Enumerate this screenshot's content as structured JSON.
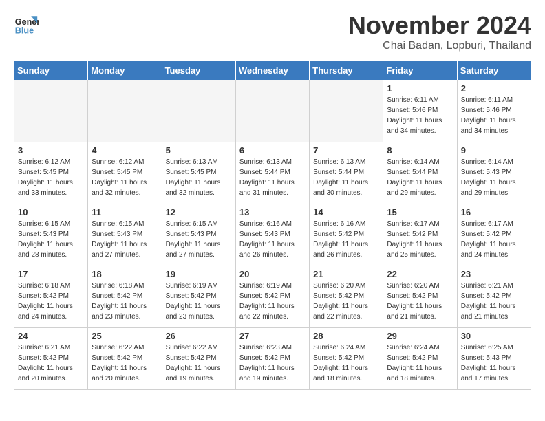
{
  "header": {
    "logo_line1": "General",
    "logo_line2": "Blue",
    "month": "November 2024",
    "location": "Chai Badan, Lopburi, Thailand"
  },
  "weekdays": [
    "Sunday",
    "Monday",
    "Tuesday",
    "Wednesday",
    "Thursday",
    "Friday",
    "Saturday"
  ],
  "weeks": [
    [
      {
        "day": "",
        "info": "",
        "empty": true
      },
      {
        "day": "",
        "info": "",
        "empty": true
      },
      {
        "day": "",
        "info": "",
        "empty": true
      },
      {
        "day": "",
        "info": "",
        "empty": true
      },
      {
        "day": "",
        "info": "",
        "empty": true
      },
      {
        "day": "1",
        "info": "Sunrise: 6:11 AM\nSunset: 5:46 PM\nDaylight: 11 hours\nand 34 minutes.",
        "empty": false
      },
      {
        "day": "2",
        "info": "Sunrise: 6:11 AM\nSunset: 5:46 PM\nDaylight: 11 hours\nand 34 minutes.",
        "empty": false
      }
    ],
    [
      {
        "day": "3",
        "info": "Sunrise: 6:12 AM\nSunset: 5:45 PM\nDaylight: 11 hours\nand 33 minutes.",
        "empty": false
      },
      {
        "day": "4",
        "info": "Sunrise: 6:12 AM\nSunset: 5:45 PM\nDaylight: 11 hours\nand 32 minutes.",
        "empty": false
      },
      {
        "day": "5",
        "info": "Sunrise: 6:13 AM\nSunset: 5:45 PM\nDaylight: 11 hours\nand 32 minutes.",
        "empty": false
      },
      {
        "day": "6",
        "info": "Sunrise: 6:13 AM\nSunset: 5:44 PM\nDaylight: 11 hours\nand 31 minutes.",
        "empty": false
      },
      {
        "day": "7",
        "info": "Sunrise: 6:13 AM\nSunset: 5:44 PM\nDaylight: 11 hours\nand 30 minutes.",
        "empty": false
      },
      {
        "day": "8",
        "info": "Sunrise: 6:14 AM\nSunset: 5:44 PM\nDaylight: 11 hours\nand 29 minutes.",
        "empty": false
      },
      {
        "day": "9",
        "info": "Sunrise: 6:14 AM\nSunset: 5:43 PM\nDaylight: 11 hours\nand 29 minutes.",
        "empty": false
      }
    ],
    [
      {
        "day": "10",
        "info": "Sunrise: 6:15 AM\nSunset: 5:43 PM\nDaylight: 11 hours\nand 28 minutes.",
        "empty": false
      },
      {
        "day": "11",
        "info": "Sunrise: 6:15 AM\nSunset: 5:43 PM\nDaylight: 11 hours\nand 27 minutes.",
        "empty": false
      },
      {
        "day": "12",
        "info": "Sunrise: 6:15 AM\nSunset: 5:43 PM\nDaylight: 11 hours\nand 27 minutes.",
        "empty": false
      },
      {
        "day": "13",
        "info": "Sunrise: 6:16 AM\nSunset: 5:43 PM\nDaylight: 11 hours\nand 26 minutes.",
        "empty": false
      },
      {
        "day": "14",
        "info": "Sunrise: 6:16 AM\nSunset: 5:42 PM\nDaylight: 11 hours\nand 26 minutes.",
        "empty": false
      },
      {
        "day": "15",
        "info": "Sunrise: 6:17 AM\nSunset: 5:42 PM\nDaylight: 11 hours\nand 25 minutes.",
        "empty": false
      },
      {
        "day": "16",
        "info": "Sunrise: 6:17 AM\nSunset: 5:42 PM\nDaylight: 11 hours\nand 24 minutes.",
        "empty": false
      }
    ],
    [
      {
        "day": "17",
        "info": "Sunrise: 6:18 AM\nSunset: 5:42 PM\nDaylight: 11 hours\nand 24 minutes.",
        "empty": false
      },
      {
        "day": "18",
        "info": "Sunrise: 6:18 AM\nSunset: 5:42 PM\nDaylight: 11 hours\nand 23 minutes.",
        "empty": false
      },
      {
        "day": "19",
        "info": "Sunrise: 6:19 AM\nSunset: 5:42 PM\nDaylight: 11 hours\nand 23 minutes.",
        "empty": false
      },
      {
        "day": "20",
        "info": "Sunrise: 6:19 AM\nSunset: 5:42 PM\nDaylight: 11 hours\nand 22 minutes.",
        "empty": false
      },
      {
        "day": "21",
        "info": "Sunrise: 6:20 AM\nSunset: 5:42 PM\nDaylight: 11 hours\nand 22 minutes.",
        "empty": false
      },
      {
        "day": "22",
        "info": "Sunrise: 6:20 AM\nSunset: 5:42 PM\nDaylight: 11 hours\nand 21 minutes.",
        "empty": false
      },
      {
        "day": "23",
        "info": "Sunrise: 6:21 AM\nSunset: 5:42 PM\nDaylight: 11 hours\nand 21 minutes.",
        "empty": false
      }
    ],
    [
      {
        "day": "24",
        "info": "Sunrise: 6:21 AM\nSunset: 5:42 PM\nDaylight: 11 hours\nand 20 minutes.",
        "empty": false
      },
      {
        "day": "25",
        "info": "Sunrise: 6:22 AM\nSunset: 5:42 PM\nDaylight: 11 hours\nand 20 minutes.",
        "empty": false
      },
      {
        "day": "26",
        "info": "Sunrise: 6:22 AM\nSunset: 5:42 PM\nDaylight: 11 hours\nand 19 minutes.",
        "empty": false
      },
      {
        "day": "27",
        "info": "Sunrise: 6:23 AM\nSunset: 5:42 PM\nDaylight: 11 hours\nand 19 minutes.",
        "empty": false
      },
      {
        "day": "28",
        "info": "Sunrise: 6:24 AM\nSunset: 5:42 PM\nDaylight: 11 hours\nand 18 minutes.",
        "empty": false
      },
      {
        "day": "29",
        "info": "Sunrise: 6:24 AM\nSunset: 5:42 PM\nDaylight: 11 hours\nand 18 minutes.",
        "empty": false
      },
      {
        "day": "30",
        "info": "Sunrise: 6:25 AM\nSunset: 5:43 PM\nDaylight: 11 hours\nand 17 minutes.",
        "empty": false
      }
    ]
  ]
}
